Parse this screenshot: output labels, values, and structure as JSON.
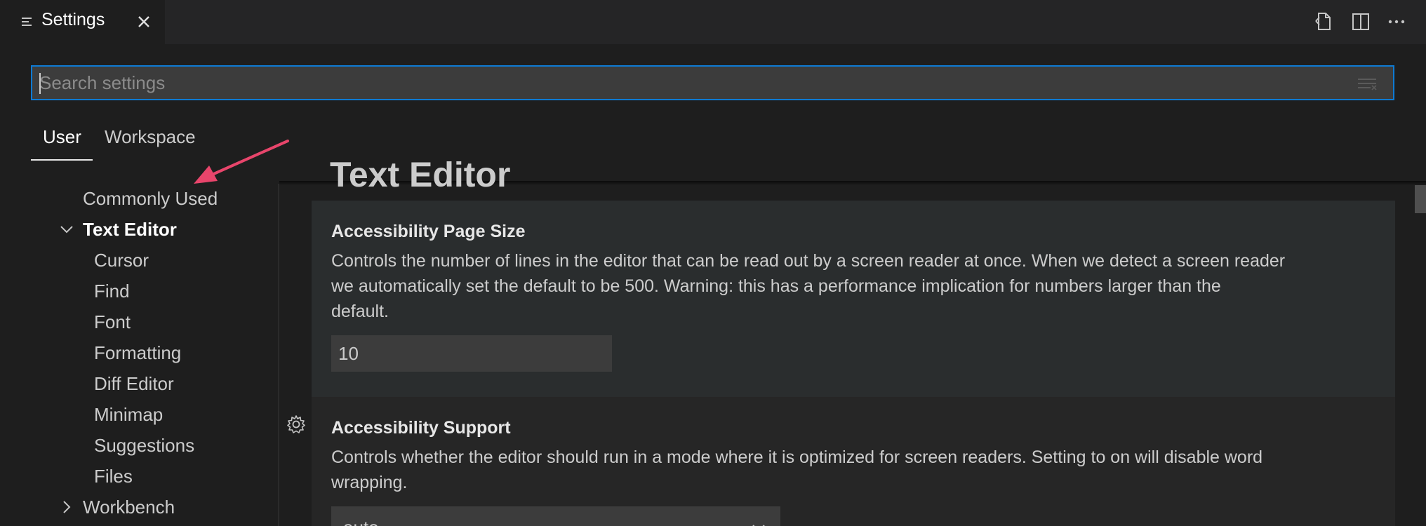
{
  "tab": {
    "title": "Settings",
    "icon": "settings-list-icon"
  },
  "toolbar": {
    "actions": [
      "open-settings-json-icon",
      "split-editor-icon",
      "more-actions-icon"
    ]
  },
  "search": {
    "placeholder": "Search settings",
    "value": ""
  },
  "scopes": {
    "user": "User",
    "workspace": "Workspace",
    "active": "User"
  },
  "toc": {
    "commonly_used": "Commonly Used",
    "text_editor": "Text Editor",
    "children": [
      "Cursor",
      "Find",
      "Font",
      "Formatting",
      "Diff Editor",
      "Minimap",
      "Suggestions",
      "Files"
    ],
    "workbench": "Workbench"
  },
  "content": {
    "section_heading": "Text Editor",
    "settings": [
      {
        "title": "Accessibility Page Size",
        "description_lines": [
          "Controls the number of lines in the editor that can be read out by a screen reader at once. When we detect a screen reader",
          "we automatically set the default to be 500. Warning: this has a performance implication for numbers larger than the",
          "default."
        ],
        "value": "10"
      },
      {
        "title": "Accessibility Support",
        "description_lines": [
          "Controls whether the editor should run in a mode where it is optimized for screen readers. Setting to on will disable word",
          "wrapping."
        ],
        "value": "auto"
      }
    ]
  },
  "colors": {
    "accent": "#0e7ad3",
    "annotation_arrow": "#e8456b",
    "background": "#1e1e1e"
  }
}
